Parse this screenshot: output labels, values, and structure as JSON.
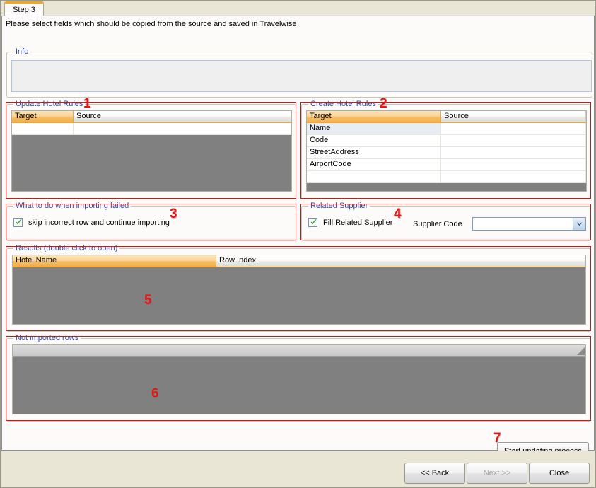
{
  "window": {
    "background_color": "#E9E6D6",
    "content_color": "#FDFAFA"
  },
  "tab": {
    "label": "Step 3",
    "accent_color": "#F2A818"
  },
  "instruction": "Please select fields which should be copied from the source and saved in Travelwise",
  "groups": {
    "info": {
      "title": "Info",
      "panel_text": ""
    },
    "update_hotel_rules": {
      "title": "Update Hotel Rules",
      "annotation": "1",
      "columns": [
        "Target",
        "Source"
      ],
      "selected_column": "Target",
      "rows": [
        {
          "target": "",
          "source": ""
        }
      ]
    },
    "create_hotel_rules": {
      "title": "Create Hotel Rules",
      "annotation": "2",
      "columns": [
        "Target",
        "Source"
      ],
      "selected_column": "Target",
      "rows": [
        {
          "target": "Name",
          "source": ""
        },
        {
          "target": "Code",
          "source": ""
        },
        {
          "target": "StreetAddress",
          "source": ""
        },
        {
          "target": "AirportCode",
          "source": ""
        },
        {
          "target": "",
          "source": ""
        }
      ]
    },
    "importing_failed": {
      "title": "What to do when importing failed",
      "annotation": "3",
      "checkbox_label": "skip incorrect row and continue importing",
      "checkbox_checked": true
    },
    "related_supplier": {
      "title": "Related Supplier",
      "annotation": "4",
      "checkbox_label": "Fill Related Supplier",
      "checkbox_checked": true,
      "supplier_code_label": "Supplier Code",
      "supplier_code_value": "",
      "supplier_code_placeholder": ""
    },
    "results": {
      "title": "Results (double click to open)",
      "annotation": "5",
      "columns": [
        "Hotel Name",
        "Row Index"
      ],
      "selected_column": "Hotel Name",
      "rows": []
    },
    "not_imported_rows": {
      "title": "Not imported rows",
      "annotation": "6",
      "columns": [],
      "rows": []
    }
  },
  "actions": {
    "start_updating": {
      "label": "Start updating process",
      "annotation": "7",
      "enabled": true
    },
    "back": {
      "label": "<< Back",
      "enabled": true
    },
    "next": {
      "label": "Next >>",
      "enabled": false
    },
    "close": {
      "label": "Close",
      "enabled": true
    }
  },
  "colors": {
    "group_title": "#2b4b9b",
    "annotation": "#e81414",
    "header_selected": "#F2AE47",
    "grid_empty": "#808080",
    "check_green": "#22A32C"
  }
}
